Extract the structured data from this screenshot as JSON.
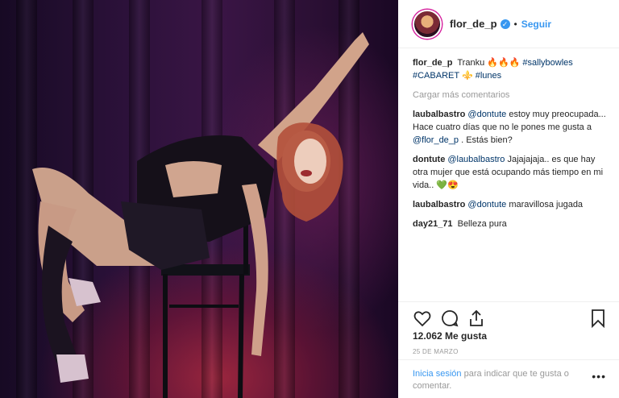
{
  "post": {
    "username": "flor_de_p",
    "verified_symbol": "✓",
    "separator": "•",
    "follow_label": "Seguir"
  },
  "caption": {
    "username": "flor_de_p",
    "text_pre": " Tranku ",
    "emojis": "🔥🔥🔥",
    "tag1": "#sallybowles",
    "tag2": "#CABARET",
    "emoji2": "⚜️",
    "tag3": "#lunes"
  },
  "load_more_label": "Cargar más comentarios",
  "comments": [
    {
      "user": "laubalbastro",
      "mention": "@dontute",
      "text": " estoy muy preocupada... Hace cuatro días que no le pones me gusta a ",
      "mention2": "@flor_de_p",
      "text2": " . Estás bien?"
    },
    {
      "user": "dontute",
      "mention": "@laubalbastro",
      "text": " Jajajajaja.. es que hay otra mujer que está ocupando más tiempo en mi vida.. ",
      "mention2": "",
      "text2": "💚😍"
    },
    {
      "user": "laubalbastro",
      "mention": "@dontute",
      "text": " maravillosa jugada",
      "mention2": "",
      "text2": ""
    },
    {
      "user": "day21_71",
      "mention": "",
      "text": " Belleza pura",
      "mention2": "",
      "text2": ""
    }
  ],
  "likes_label": "12.062 Me gusta",
  "date_label": "25 DE MARZO",
  "login": {
    "link": "Inicia sesión",
    "text": " para indicar que te gusta o comentar."
  },
  "menu_dots": "•••",
  "icons": {
    "like": "heart-icon",
    "comment": "comment-icon",
    "share": "share-icon",
    "save": "bookmark-icon"
  },
  "colors": {
    "link_blue": "#3897f0",
    "mention_blue": "#003569",
    "muted": "#999999"
  }
}
